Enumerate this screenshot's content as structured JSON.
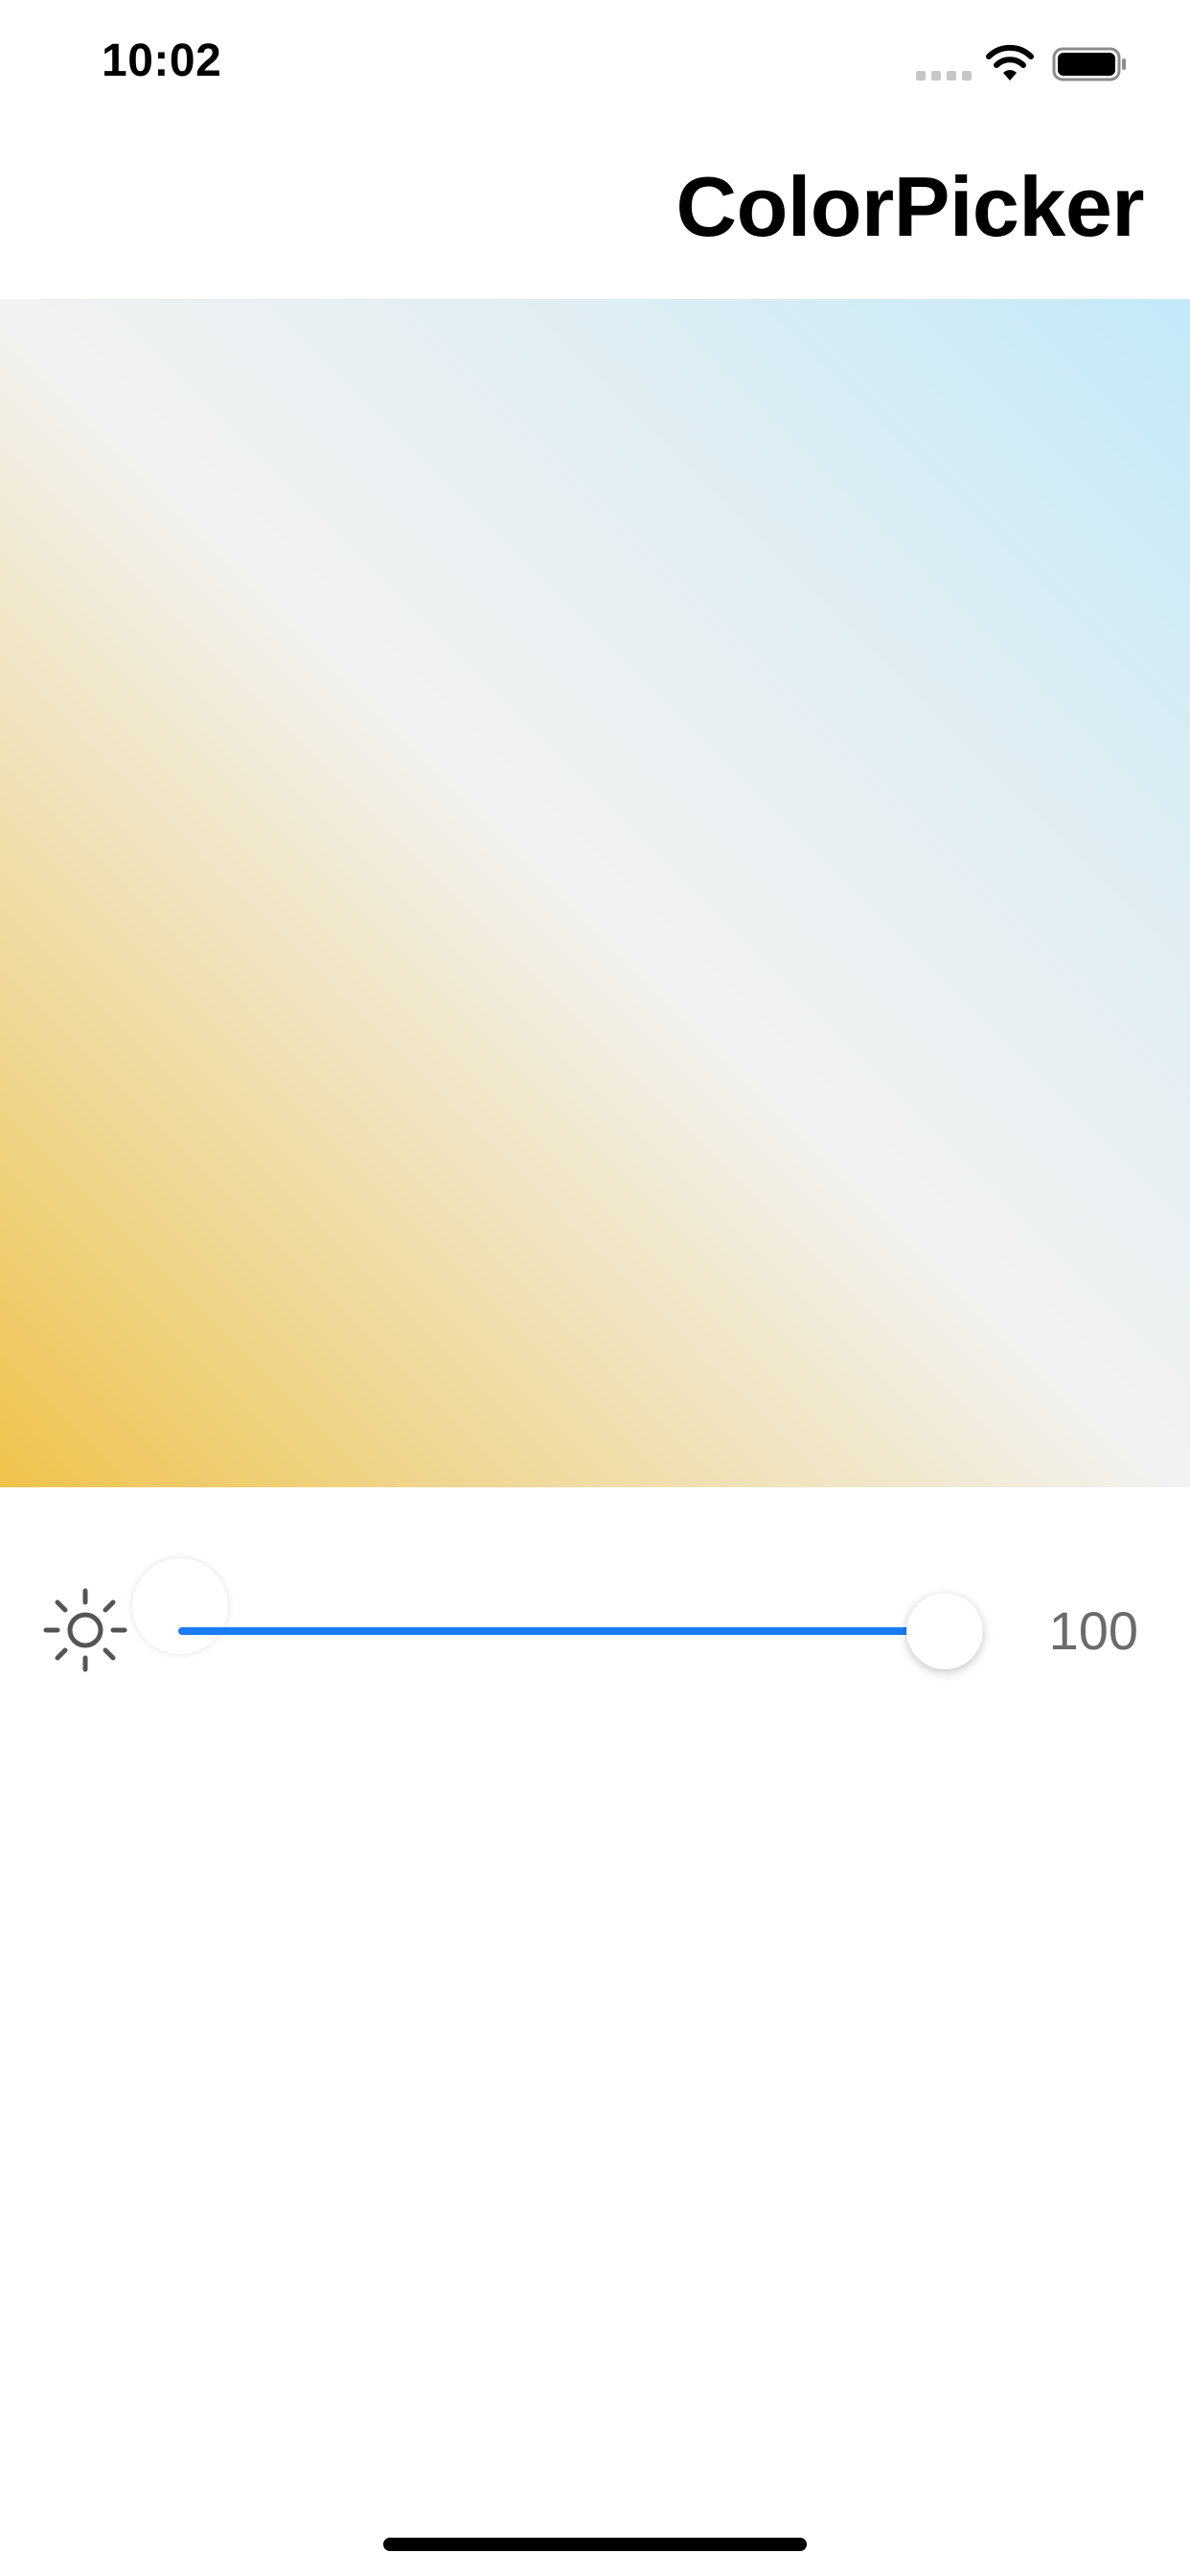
{
  "status_bar": {
    "time": "10:02",
    "icons": [
      "cellular-signal-icon",
      "wifi-icon",
      "battery-icon"
    ]
  },
  "navigation": {
    "title": "ColorPicker"
  },
  "color_plane": {
    "gradient_colors": [
      "#efc34c",
      "#f2f2f2",
      "#c3e9f8"
    ],
    "handle_color": "#ffffff"
  },
  "brightness": {
    "icon": "sun-icon",
    "value": 100,
    "value_label": "100",
    "max": 100,
    "accent_color": "#1a7cf5"
  }
}
